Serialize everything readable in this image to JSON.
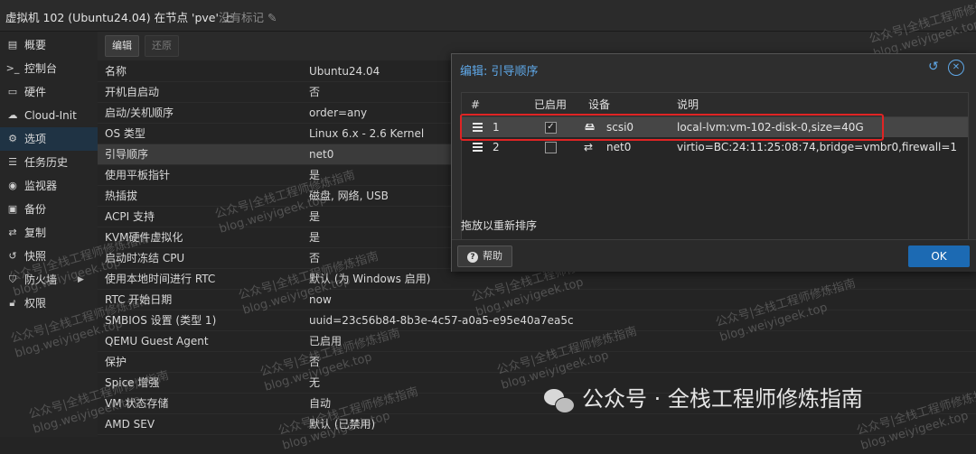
{
  "header": {
    "title": "虚拟机 102 (Ubuntu24.04) 在节点 'pve' 上",
    "no_tags": "没有标记"
  },
  "sidebar": {
    "items": [
      {
        "label": "概要",
        "icon": "book-icon"
      },
      {
        "label": "控制台",
        "icon": "terminal-icon"
      },
      {
        "label": "硬件",
        "icon": "monitor-icon"
      },
      {
        "label": "Cloud-Init",
        "icon": "cloud-icon"
      },
      {
        "label": "选项",
        "icon": "gear-icon",
        "active": true
      },
      {
        "label": "任务历史",
        "icon": "list-icon"
      },
      {
        "label": "监视器",
        "icon": "eye-icon"
      },
      {
        "label": "备份",
        "icon": "floppy-icon"
      },
      {
        "label": "复制",
        "icon": "retweet-icon"
      },
      {
        "label": "快照",
        "icon": "history-icon"
      },
      {
        "label": "防火墙",
        "icon": "shield-icon",
        "has_submenu": true
      },
      {
        "label": "权限",
        "icon": "unlock-icon"
      }
    ]
  },
  "toolbar": {
    "edit_label": "编辑",
    "revert_label": "还原"
  },
  "options": [
    {
      "key": "名称",
      "value": "Ubuntu24.04"
    },
    {
      "key": "开机自启动",
      "value": "否"
    },
    {
      "key": "启动/关机顺序",
      "value": "order=any"
    },
    {
      "key": "OS 类型",
      "value": "Linux 6.x - 2.6 Kernel"
    },
    {
      "key": "引导顺序",
      "value": "net0",
      "selected": true
    },
    {
      "key": "使用平板指针",
      "value": "是"
    },
    {
      "key": "热插拔",
      "value": "磁盘, 网络, USB"
    },
    {
      "key": "ACPI 支持",
      "value": "是"
    },
    {
      "key": "KVM硬件虚拟化",
      "value": "是"
    },
    {
      "key": "启动时冻结 CPU",
      "value": "否"
    },
    {
      "key": "使用本地时间进行 RTC",
      "value": "默认 (为 Windows 启用)"
    },
    {
      "key": "RTC 开始日期",
      "value": "now"
    },
    {
      "key": "SMBIOS 设置 (类型 1)",
      "value": "uuid=23c56b84-8b3e-4c57-a0a5-e95e40a7ea5c"
    },
    {
      "key": "QEMU Guest Agent",
      "value": "已启用"
    },
    {
      "key": "保护",
      "value": "否"
    },
    {
      "key": "Spice 增强",
      "value": "无"
    },
    {
      "key": "VM 状态存储",
      "value": "自动"
    },
    {
      "key": "AMD SEV",
      "value": "默认 (已禁用)"
    }
  ],
  "dialog": {
    "title": "编辑: 引导顺序",
    "columns": {
      "index": "#",
      "enabled": "已启用",
      "device": "设备",
      "description": "说明"
    },
    "rows": [
      {
        "index": "1",
        "enabled": true,
        "device": "scsi0",
        "device_icon": "hdd-icon",
        "description": "local-lvm:vm-102-disk-0,size=40G",
        "selected": true
      },
      {
        "index": "2",
        "enabled": false,
        "device": "net0",
        "device_icon": "exchange-icon",
        "description": "virtio=BC:24:11:25:08:74,bridge=vmbr0,firewall=1"
      }
    ],
    "drag_hint": "拖放以重新排序",
    "help_label": "帮助",
    "ok_label": "OK"
  },
  "watermark": {
    "line1": "公众号|全栈工程师修炼指南",
    "line2": "blog.weiyigeek.top"
  },
  "badge": {
    "text": "公众号 · 全栈工程师修炼指南"
  },
  "colors": {
    "accent": "#5fa8e8",
    "ok_button": "#1c6ab3",
    "highlight_box": "#e02424",
    "selected_nav": "#1f3344"
  }
}
